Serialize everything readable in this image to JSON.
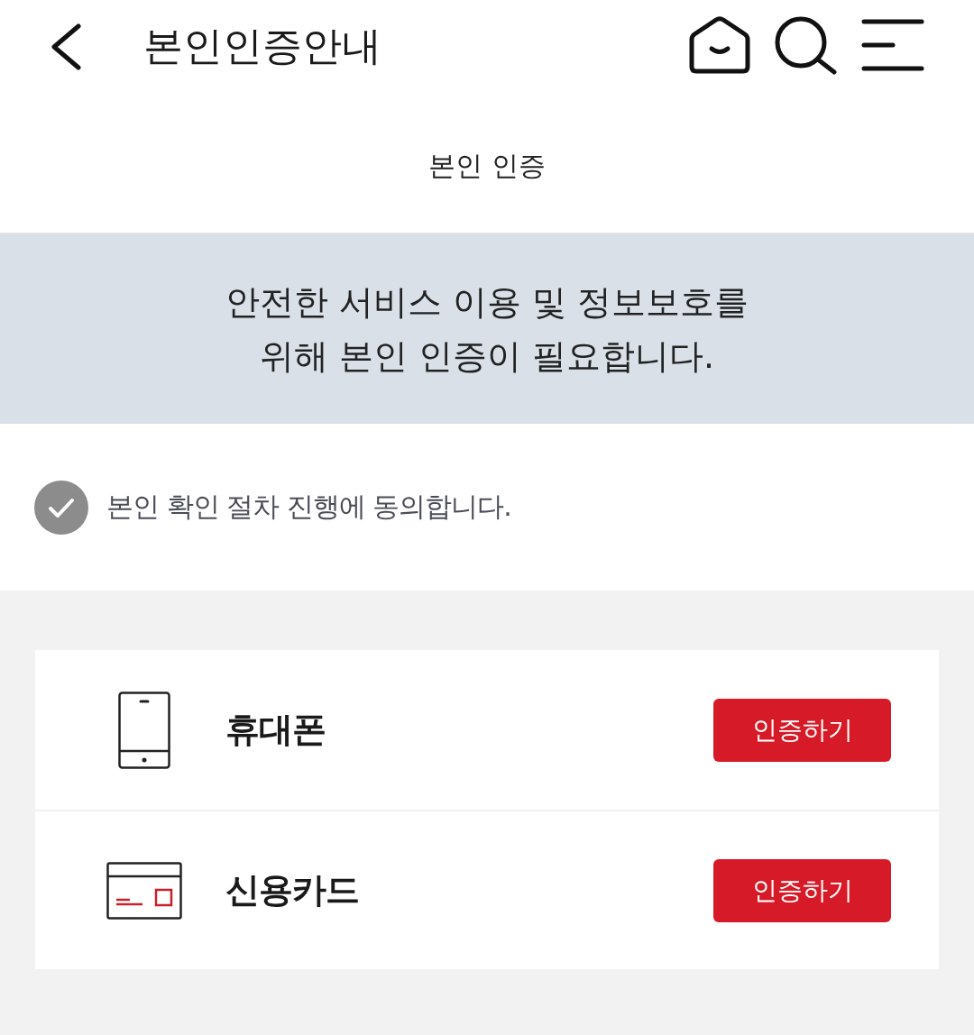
{
  "header": {
    "title": "본인인증안내"
  },
  "section_title": "본인 인증",
  "notice": {
    "lines": [
      "안전한 서비스 이용 및 정보보호를",
      "위해 본인 인증이 필요합니다."
    ]
  },
  "agreement": {
    "label": "본인 확인 절차 진행에 동의합니다.",
    "checked": false
  },
  "methods": [
    {
      "kind": "phone",
      "label": "휴대폰",
      "button": "인증하기"
    },
    {
      "kind": "card",
      "label": "신용카드",
      "button": "인증하기"
    }
  ]
}
